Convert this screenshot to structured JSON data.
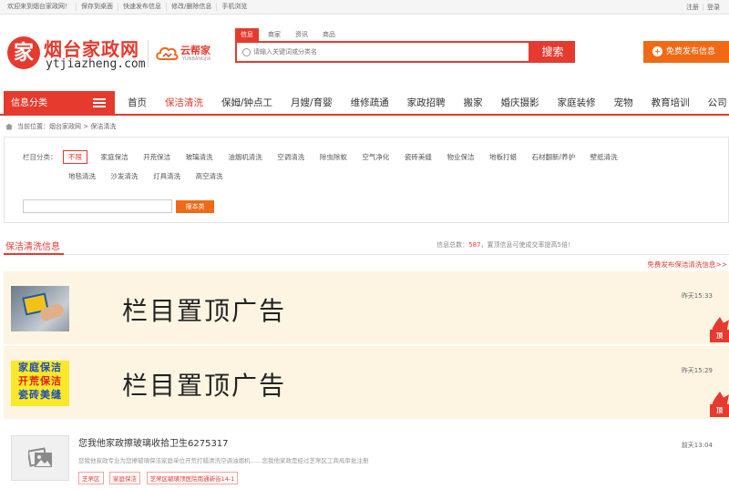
{
  "topbar": {
    "links": [
      "欢迎来到烟台家政网！",
      "保存到桌面",
      "快速发布信息",
      "修改/删除信息",
      "手机浏览"
    ],
    "auth": [
      "注册",
      "登录"
    ]
  },
  "header": {
    "logo_mark": "家",
    "logo_title": "烟台家政网",
    "logo_sub": "ytjiazheng.com",
    "partner_name": "云帮家",
    "partner_sub": "YUNBANGJIA",
    "search_tabs": [
      "信息",
      "商家",
      "资讯",
      "商品"
    ],
    "search_placeholder": "请输入关键词或分类名",
    "search_button": "搜索",
    "publish_button": "免费发布信息"
  },
  "nav": {
    "category_label": "信息分类",
    "items": [
      "首页",
      "保洁清洗",
      "保姆/钟点工",
      "月嫂/育婴",
      "维修疏通",
      "家政招聘",
      "搬家",
      "婚庆摄影",
      "家庭装修",
      "宠物",
      "教育培训",
      "公司"
    ],
    "active_index": 1
  },
  "breadcrumb": {
    "text": "当前位置：烟台家政网 > 保洁清洗"
  },
  "filter": {
    "label": "栏目分类：",
    "row1": [
      "不限",
      "家庭保洁",
      "开荒保洁",
      "玻璃清洗",
      "油烟机清洗",
      "空调清洗",
      "除虫除蚁",
      "空气净化",
      "瓷砖美缝",
      "物业保洁",
      "地板打蜡",
      "石材翻新/养护",
      "壁纸清洗"
    ],
    "row2": [
      "地毯清洗",
      "沙发清洗",
      "灯具清洗",
      "高空清洗"
    ],
    "search_button": "搜本类"
  },
  "list": {
    "title": "保洁清洗信息",
    "stat_prefix": "信息总数：",
    "stat_count": "587",
    "stat_suffix": "，置顶信息可使成交率提高5倍！",
    "free_link": "免费发布保洁清洗信息>>"
  },
  "ads": [
    {
      "slogan": "栏目置顶广告",
      "time": "昨天15:33",
      "badge": "顶"
    },
    {
      "slogan": "栏目置顶广告",
      "time": "昨天15:29",
      "badge": "顶",
      "thumb_lines": [
        "家庭保洁",
        "开荒保洁",
        "瓷砖美缝"
      ]
    }
  ],
  "item": {
    "title": "您我他家政擦玻璃收拾卫生6275317",
    "desc": "您我他家政专业为您擦玻璃保洁家庭单位开荒打蜡清洗空调油烟机……您我他家政是经过芝罘区工商局审批注册",
    "tags": [
      "芝罘区",
      "家庭保洁",
      "芝罘区毓璜顶医院南通新街14-1"
    ],
    "time": "前天13:04"
  },
  "colors": {
    "accent": "#e63a2e",
    "orange": "#f06a16",
    "ad_bg": "#fdf5e2"
  }
}
